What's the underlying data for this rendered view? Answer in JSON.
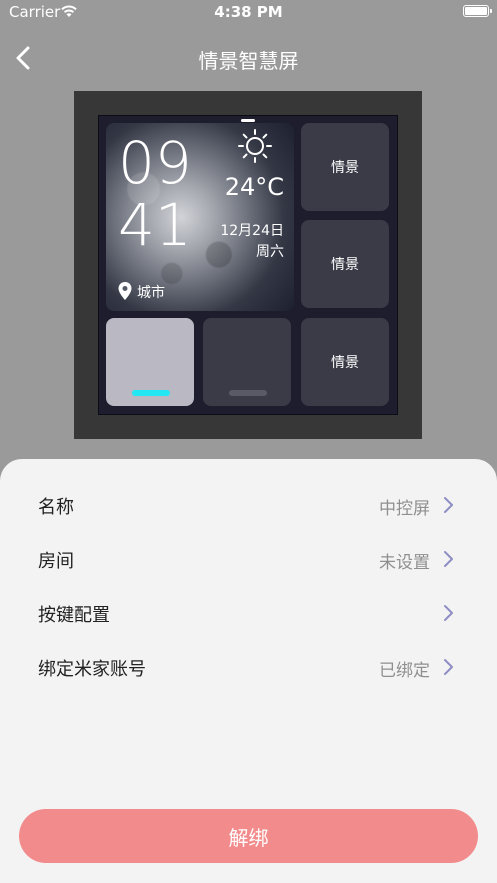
{
  "status_bar": {
    "carrier": "Carrier",
    "time": "4:38 PM"
  },
  "nav": {
    "title": "情景智慧屏"
  },
  "device": {
    "clock_hour": "09",
    "clock_minute": "41",
    "temperature": "24°C",
    "date": "12月24日",
    "weekday": "周六",
    "city": "城市",
    "scene_labels": [
      "情景",
      "情景",
      "情景"
    ],
    "switch_on_color": "#23e7f2"
  },
  "settings": {
    "rows": [
      {
        "label": "名称",
        "value": "中控屏"
      },
      {
        "label": "房间",
        "value": "未设置"
      },
      {
        "label": "按键配置",
        "value": ""
      },
      {
        "label": "绑定米家账号",
        "value": "已绑定"
      }
    ],
    "unbind_label": "解绑"
  }
}
